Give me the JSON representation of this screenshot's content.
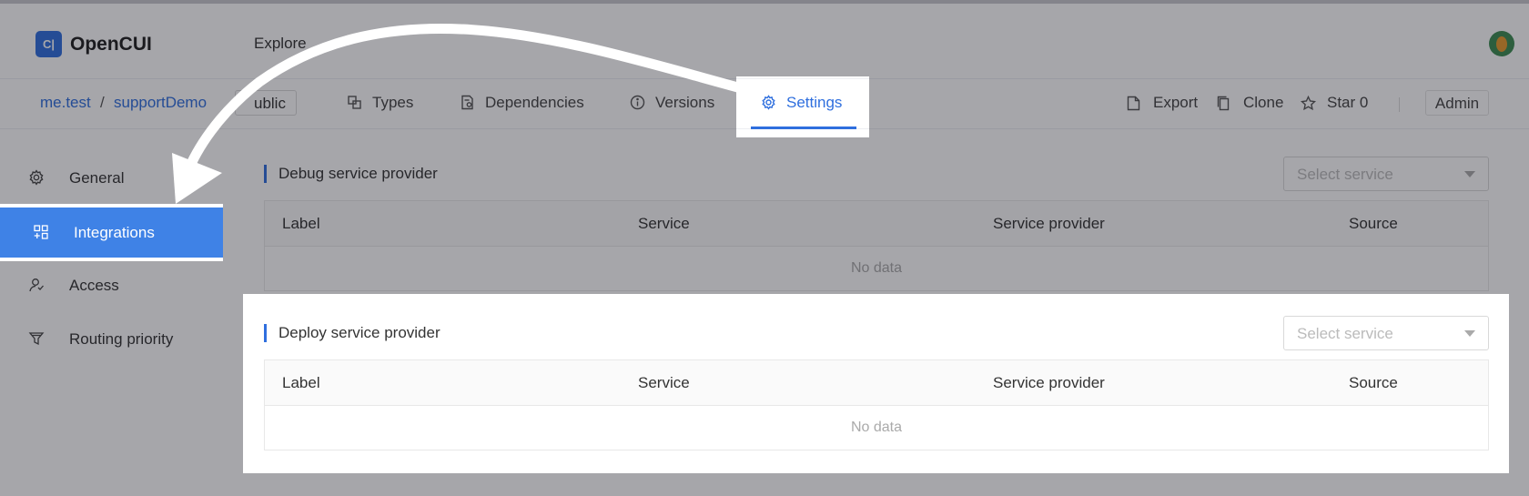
{
  "app": {
    "logo_mark": "C|",
    "name": "OpenCUI",
    "explore": "Explore"
  },
  "breadcrumb": {
    "org": "me.test",
    "separator": "/",
    "project": "supportDemo",
    "visibility": "ublic"
  },
  "tabs": [
    {
      "label": "Types",
      "icon": "types-icon"
    },
    {
      "label": "Dependencies",
      "icon": "dependencies-icon"
    },
    {
      "label": "Versions",
      "icon": "info-icon"
    },
    {
      "label": "Settings",
      "icon": "gear-icon",
      "active": true
    }
  ],
  "toolbar": {
    "export": "Export",
    "clone": "Clone",
    "star": "Star 0",
    "admin": "Admin"
  },
  "sidebar": {
    "items": [
      {
        "label": "General",
        "icon": "gear-icon"
      },
      {
        "label": "Integrations",
        "icon": "integrations-icon",
        "active": true
      },
      {
        "label": "Access",
        "icon": "users-icon"
      },
      {
        "label": "Routing priority",
        "icon": "filter-icon"
      }
    ]
  },
  "debug_section": {
    "title": "Debug service provider",
    "select_placeholder": "Select service",
    "columns": [
      "Label",
      "Service",
      "Service provider",
      "Source"
    ],
    "empty": "No data"
  },
  "deploy_section": {
    "title": "Deploy service provider",
    "select_placeholder": "Select service",
    "columns": [
      "Label",
      "Service",
      "Service provider",
      "Source"
    ],
    "empty": "No data"
  },
  "colors": {
    "accent": "#2f6fde",
    "sidebar_active": "#3f82e6",
    "overlay": "rgba(20,20,32,0.38)"
  }
}
